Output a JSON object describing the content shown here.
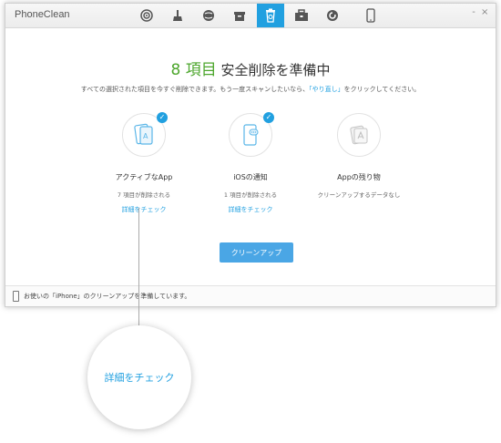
{
  "window": {
    "app_name": "PhoneClean",
    "toolbar_icons": [
      "target-icon",
      "broom-icon",
      "globe-icon",
      "box-icon",
      "trash-icon",
      "briefcase-icon",
      "refresh-icon",
      "phone-icon"
    ],
    "active_toolbar_index": 4,
    "controls": [
      "-",
      "×"
    ]
  },
  "main": {
    "heading_count": "8 項目",
    "heading_text": " 安全削除を準備中",
    "subtext_before": "すべての選択された項目を今すぐ削除できます。もう一度スキャンしたいなら、",
    "subtext_link": "「やり直し」",
    "subtext_after": "をクリックしてください。",
    "categories": [
      {
        "title": "アクティブなApp",
        "sub": "7 項目が削除される",
        "link": "詳細をチェック",
        "checked": true,
        "icon": "app-icon"
      },
      {
        "title": "iOSの通知",
        "sub": "1 項目が削除される",
        "link": "詳細をチェック",
        "checked": true,
        "icon": "notification-icon"
      },
      {
        "title": "Appの残り物",
        "sub": "クリーンアップするデータなし",
        "link": "",
        "checked": false,
        "icon": "app-store-icon"
      }
    ],
    "clean_button": "クリーンアップ"
  },
  "status": {
    "text": "お使いの「iPhone」のクリーンアップを準備しています。"
  },
  "callout": {
    "text": "詳細をチェック"
  },
  "colors": {
    "accent": "#21a0e0",
    "button": "#4aa6e5",
    "count_green": "#4ca62c"
  }
}
